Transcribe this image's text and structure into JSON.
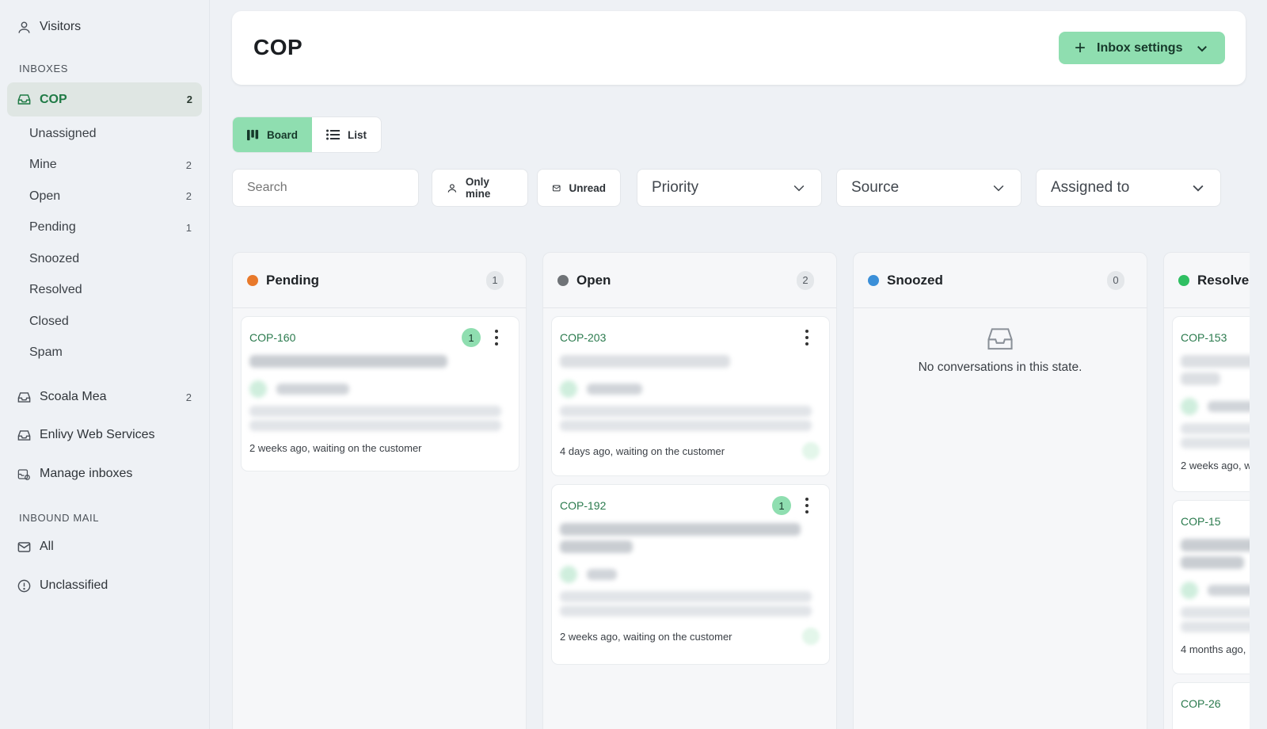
{
  "sidebar": {
    "visitors": "Visitors",
    "inboxes_heading": "INBOXES",
    "cop": {
      "label": "COP",
      "count": "2"
    },
    "cop_sub": [
      {
        "label": "Unassigned",
        "count": ""
      },
      {
        "label": "Mine",
        "count": "2"
      },
      {
        "label": "Open",
        "count": "2"
      },
      {
        "label": "Pending",
        "count": "1"
      },
      {
        "label": "Snoozed",
        "count": ""
      },
      {
        "label": "Resolved",
        "count": ""
      },
      {
        "label": "Closed",
        "count": ""
      },
      {
        "label": "Spam",
        "count": ""
      }
    ],
    "scoala": {
      "label": "Scoala Mea",
      "count": "2"
    },
    "enlivy": {
      "label": "Enlivy Web Services"
    },
    "manage": {
      "label": "Manage inboxes"
    },
    "inbound_heading": "INBOUND MAIL",
    "all": {
      "label": "All"
    },
    "unclassified": {
      "label": "Unclassified"
    }
  },
  "header": {
    "title": "COP",
    "inbox_settings": "Inbox settings"
  },
  "view": {
    "board": "Board",
    "list": "List"
  },
  "filters": {
    "search_placeholder": "Search",
    "only_mine": "Only mine",
    "unread": "Unread",
    "priority": "Priority",
    "source": "Source",
    "assigned_to": "Assigned to"
  },
  "columns": [
    {
      "name": "Pending",
      "count": "1",
      "color": "#e8792b"
    },
    {
      "name": "Open",
      "count": "2",
      "color": "#6f7377"
    },
    {
      "name": "Snoozed",
      "count": "0",
      "color": "#3b8fd8"
    },
    {
      "name": "Resolve",
      "count": "",
      "color": "#2fbf62"
    }
  ],
  "cards": {
    "pending": [
      {
        "id": "COP-160",
        "unread": "1",
        "footer": "2 weeks ago, waiting on the customer"
      }
    ],
    "open": [
      {
        "id": "COP-203",
        "unread": "",
        "footer": "4 days ago, waiting on the customer"
      },
      {
        "id": "COP-192",
        "unread": "1",
        "footer": "2 weeks ago, waiting on the customer"
      }
    ],
    "resolved": [
      {
        "id": "COP-153",
        "footer": "2 weeks ago, w"
      },
      {
        "id": "COP-15",
        "footer": "4 months ago,"
      },
      {
        "id": "COP-26",
        "footer": ""
      }
    ]
  },
  "snoozed_empty": "No conversations in this state.",
  "colors": {
    "accent": "#8fdeb0",
    "accent_text": "#1f7a45",
    "background": "#eef1f5"
  }
}
